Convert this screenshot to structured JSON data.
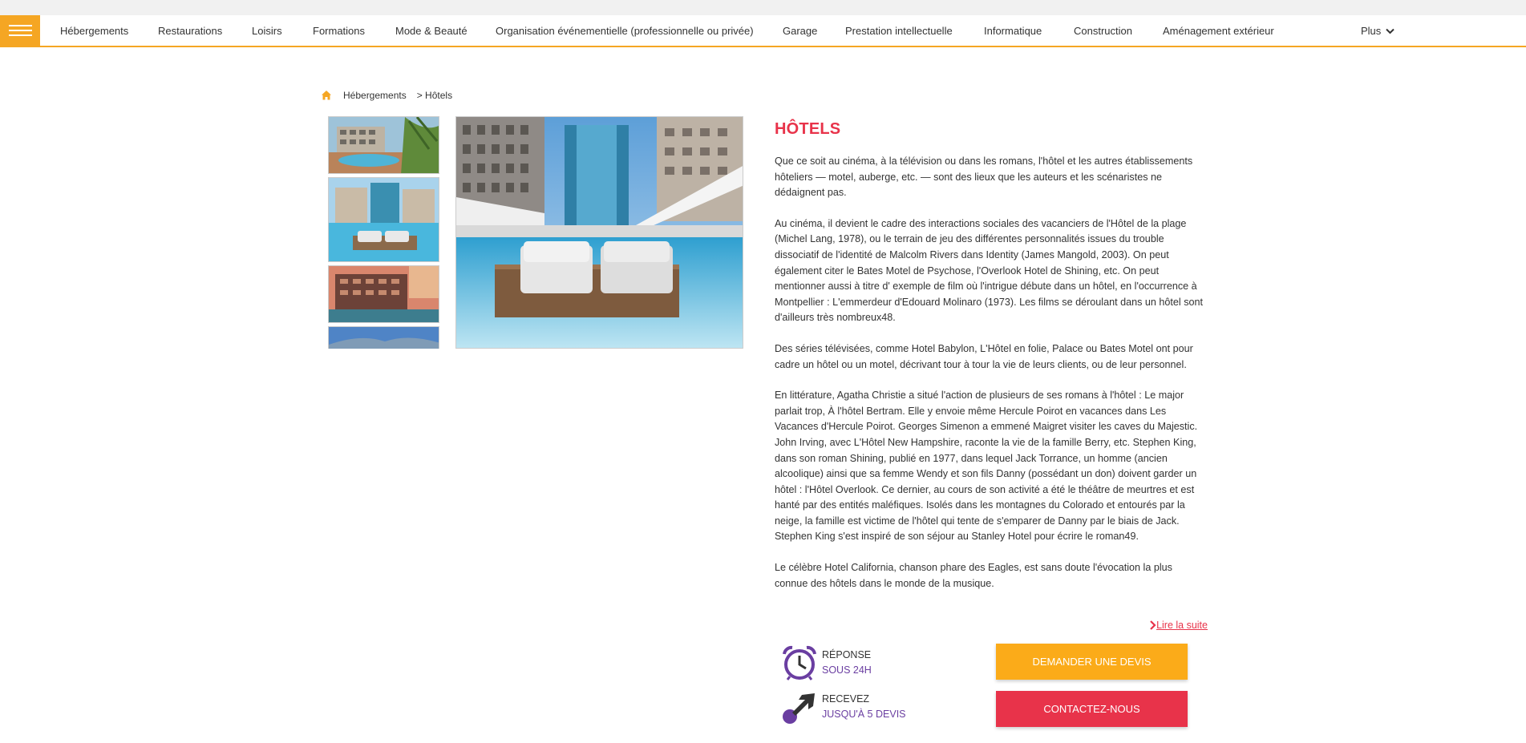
{
  "nav": {
    "items": [
      {
        "label": "Hébergements"
      },
      {
        "label": "Restaurations"
      },
      {
        "label": "Loisirs"
      },
      {
        "label": "Formations"
      },
      {
        "label": "Mode & Beauté"
      },
      {
        "label": "Organisation événementielle (professionnelle ou privée)"
      },
      {
        "label": "Garage"
      },
      {
        "label": "Prestation intellectuelle"
      },
      {
        "label": "Informatique"
      },
      {
        "label": "Construction"
      },
      {
        "label": "Aménagement extérieur"
      }
    ],
    "more_label": "Plus"
  },
  "breadcrumb": {
    "parent": "Hébergements",
    "current": "> Hôtels"
  },
  "article": {
    "title": "HÔTELS",
    "paragraphs": [
      "Que ce soit au cinéma, à la télévision ou dans les romans, l'hôtel et les autres établissements hôteliers — motel, auberge, etc. — sont des lieux que les auteurs et les scénaristes ne dédaignent pas.",
      "Au cinéma, il devient le cadre des interactions sociales des vacanciers de l'Hôtel de la plage (Michel Lang, 1978), ou le terrain de jeu des différentes personnalités issues du trouble dissociatif de l'identité de Malcolm Rivers dans Identity (James Mangold, 2003). On peut également citer le Bates Motel de Psychose, l'Overlook Hotel de Shining, etc. On peut mentionner aussi à titre d' exemple de film où l'intrigue débute dans un hôtel, en l'occurrence à Montpellier : L'emmerdeur d'Edouard Molinaro (1973). Les films se déroulant dans un hôtel sont d'ailleurs très nombreux48.",
      "Des séries télévisées, comme Hotel Babylon, L'Hôtel en folie, Palace ou Bates Motel ont pour cadre un hôtel ou un motel, décrivant tour à tour la vie de leurs clients, ou de leur personnel.",
      "En littérature, Agatha Christie a situé l'action de plusieurs de ses romans à l'hôtel : Le major parlait trop, À l'hôtel Bertram. Elle y envoie même Hercule Poirot en vacances dans Les Vacances d'Hercule Poirot. Georges Simenon a emmené Maigret visiter les caves du Majestic. John Irving, avec L'Hôtel New Hampshire, raconte la vie de la famille Berry, etc. Stephen King, dans son roman Shining, publié en 1977, dans lequel Jack Torrance, un homme (ancien alcoolique) ainsi que sa femme Wendy et son fils Danny (possédant un don) doivent garder un hôtel : l'Hôtel Overlook. Ce dernier, au cours de son activité a été le théâtre de meurtres et est hanté par des entités maléfiques. Isolés dans les montagnes du Colorado et entourés par la neige, la famille est victime de l'hôtel qui tente de s'emparer de Danny par le biais de Jack. Stephen King s'est inspiré de son séjour au Stanley Hotel pour écrire le roman49.",
      "Le célèbre Hotel California, chanson phare des Eagles, est sans doute l'évocation la plus connue des hôtels dans le monde de la musique."
    ],
    "read_more": "Lire la suite"
  },
  "features": [
    {
      "line1": "RÉPONSE",
      "line2": "SOUS 24H",
      "icon": "alarm-clock-icon"
    },
    {
      "line1": "RECEVEZ",
      "line2": "JUSQU'À 5 DEVIS",
      "icon": "arrow-icon"
    }
  ],
  "buttons": {
    "quote": "DEMANDER UNE DEVIS",
    "contact": "CONTACTEZ-NOUS"
  },
  "colors": {
    "accent": "#f5a623",
    "title_red": "#e8334a",
    "purple": "#6a3ea1",
    "button_orange": "#fbab19"
  }
}
